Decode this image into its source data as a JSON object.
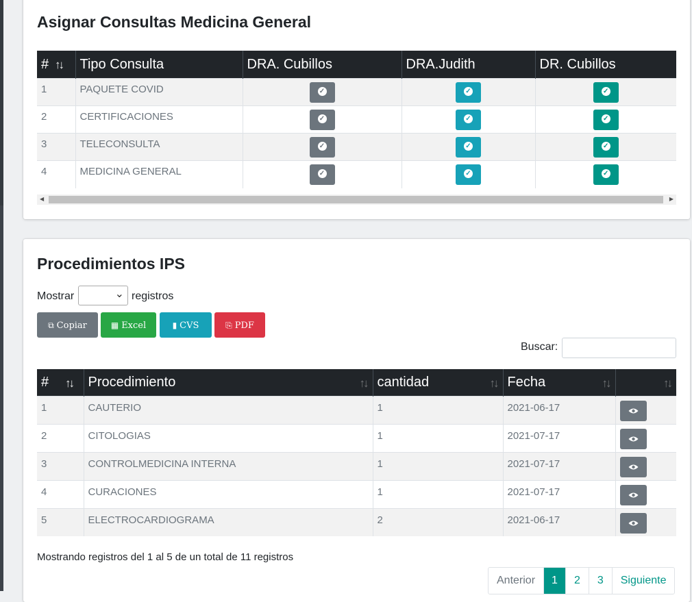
{
  "consultas": {
    "title": "Asignar Consultas Medicina General",
    "columns": [
      "#",
      "Tipo Consulta",
      "DRA. Cubillos",
      "DRA.Judith",
      "DR. Cubillos"
    ],
    "rows": [
      {
        "n": "1",
        "tipo": "PAQUETE COVID"
      },
      {
        "n": "2",
        "tipo": "CERTIFICACIONES"
      },
      {
        "n": "3",
        "tipo": "TELECONSULTA"
      },
      {
        "n": "4",
        "tipo": "MEDICINA GENERAL"
      }
    ],
    "button_colors": [
      "#6c757d",
      "#17a2b8",
      "#009688"
    ]
  },
  "procedimientos": {
    "title": "Procedimientos IPS",
    "show_label": "Mostrar",
    "records_label": "registros",
    "length_select_value": "",
    "export_buttons": {
      "copy": "Copiar",
      "excel": "Excel",
      "csv": "CVS",
      "pdf": "PDF"
    },
    "search_label": "Buscar:",
    "search_value": "",
    "columns": [
      "#",
      "Procedimiento",
      "cantidad",
      "Fecha",
      ""
    ],
    "rows": [
      {
        "n": "1",
        "procedimiento": "CAUTERIO",
        "cantidad": "1",
        "fecha": "2021-06-17"
      },
      {
        "n": "2",
        "procedimiento": "CITOLOGIAS",
        "cantidad": "1",
        "fecha": "2021-07-17"
      },
      {
        "n": "3",
        "procedimiento": "CONTROLMEDICINA INTERNA",
        "cantidad": "1",
        "fecha": "2021-07-17"
      },
      {
        "n": "4",
        "procedimiento": "CURACIONES",
        "cantidad": "1",
        "fecha": "2021-07-17"
      },
      {
        "n": "5",
        "procedimiento": "ELECTROCARDIOGRAMA",
        "cantidad": "2",
        "fecha": "2021-06-17"
      }
    ],
    "info": "Mostrando registros del 1 al 5 de un total de 11 registros",
    "pagination": {
      "prev": "Anterior",
      "pages": [
        "1",
        "2",
        "3"
      ],
      "active_page": "1",
      "next": "Siguiente"
    },
    "accent_color": "#009688"
  }
}
